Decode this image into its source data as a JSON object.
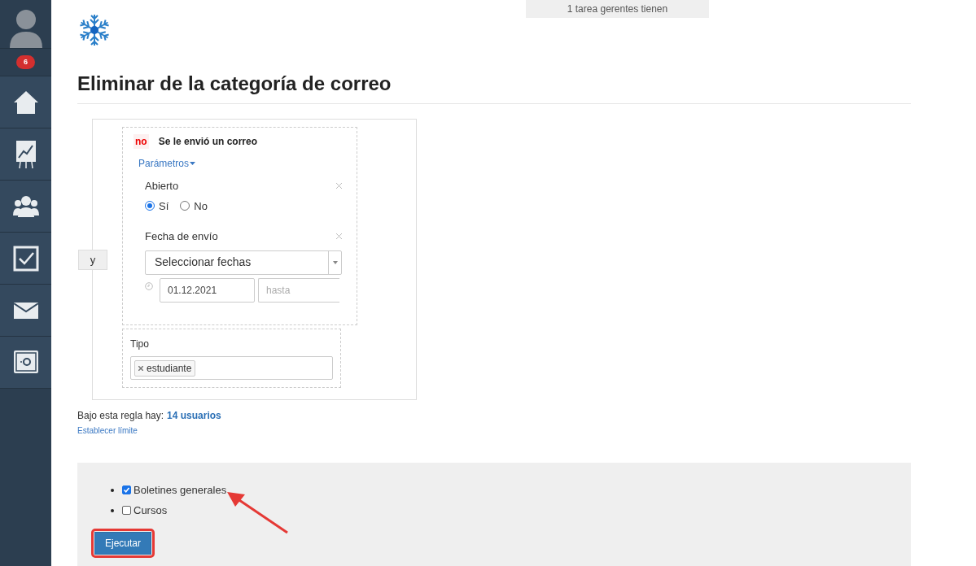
{
  "sidebar": {
    "badge": "6",
    "items": [
      {
        "kind": "home"
      },
      {
        "kind": "chart"
      },
      {
        "kind": "people"
      },
      {
        "kind": "tasks"
      },
      {
        "kind": "mail"
      },
      {
        "kind": "safe"
      }
    ]
  },
  "top_notice": "1 tarea gerentes tienen",
  "title": "Eliminar de la categoría de correo",
  "rule": {
    "operator": "y",
    "condition": {
      "negation": "no",
      "label": "Se le envió un correo",
      "params_link": "Parámetros",
      "opened": {
        "label": "Abierto",
        "options": [
          {
            "label": "Sí",
            "selected": true
          },
          {
            "label": "No",
            "selected": false
          }
        ]
      },
      "send_date": {
        "label": "Fecha de envío",
        "select": "Seleccionar fechas",
        "from": "01.12.2021",
        "to_placeholder": "hasta"
      }
    },
    "type": {
      "label": "Tipo",
      "tags": [
        "estudiante"
      ]
    }
  },
  "summary": {
    "text": "Bajo esta regla hay:",
    "count": "14 usuarios",
    "limit_link": "Establecer límite"
  },
  "categories": [
    {
      "label": "Boletines generales",
      "checked": true
    },
    {
      "label": "Cursos",
      "checked": false
    }
  ],
  "run_button": "Ejecutar"
}
